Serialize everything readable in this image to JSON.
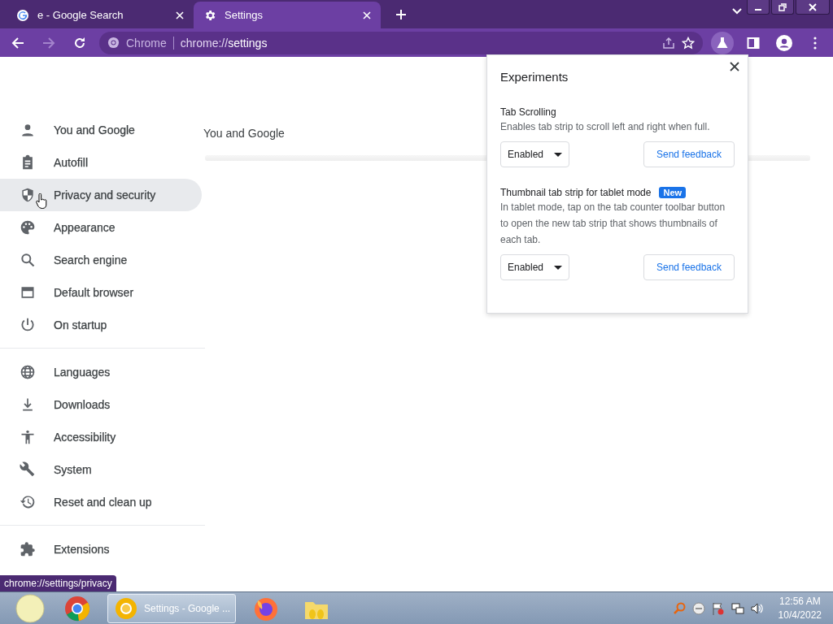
{
  "tabs": [
    {
      "title": "e - Google Search",
      "selected": false
    },
    {
      "title": "Settings",
      "selected": true
    }
  ],
  "omnibox": {
    "site_label": "Chrome",
    "url_prefix": "chrome://",
    "url_path": "settings"
  },
  "sidebar": {
    "groups": [
      [
        {
          "label": "You and Google",
          "selected": false
        },
        {
          "label": "Autofill",
          "selected": false
        },
        {
          "label": "Privacy and security",
          "selected": true
        },
        {
          "label": "Appearance",
          "selected": false
        },
        {
          "label": "Search engine",
          "selected": false
        },
        {
          "label": "Default browser",
          "selected": false
        },
        {
          "label": "On startup",
          "selected": false
        }
      ],
      [
        {
          "label": "Languages",
          "selected": false
        },
        {
          "label": "Downloads",
          "selected": false
        },
        {
          "label": "Accessibility",
          "selected": false
        },
        {
          "label": "System",
          "selected": false
        },
        {
          "label": "Reset and clean up",
          "selected": false
        }
      ],
      [
        {
          "label": "Extensions",
          "selected": false
        }
      ]
    ]
  },
  "main": {
    "section_title": "You and Google"
  },
  "experiments": {
    "title": "Experiments",
    "items": [
      {
        "name": "Tab Scrolling",
        "description": "Enables tab strip to scroll left and right when full.",
        "value": "Enabled",
        "button": "Send feedback"
      },
      {
        "name": "Thumbnail tab strip for tablet mode",
        "badge": "New",
        "description": "In tablet mode, tap on the tab counter toolbar button to open the new tab strip that shows thumbnails of each tab.",
        "value": "Enabled",
        "button": "Send feedback"
      }
    ]
  },
  "status_tooltip": "chrome://settings/privacy",
  "taskbar": {
    "task": {
      "label": "Settings - Google ...",
      "selected": true
    },
    "clock": {
      "time": "12:56 AM",
      "date": "10/4/2022"
    }
  }
}
